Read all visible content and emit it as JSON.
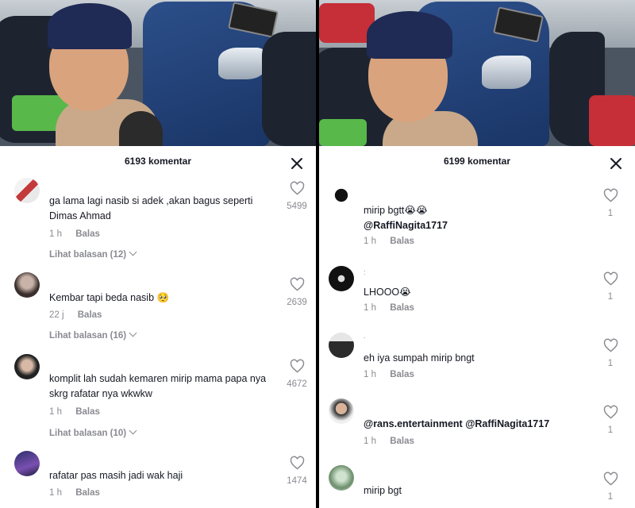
{
  "left": {
    "header_title": "6193 komentar",
    "comments": [
      {
        "text": "ga lama lagi nasib si adek ,akan bagus seperti Dimas Ahmad",
        "time": "1 h",
        "reply_label": "Balas",
        "likes": "5499",
        "view_replies": "Lihat balasan (12)"
      },
      {
        "text": "Kembar tapi beda nasib",
        "emoji": "🥺",
        "time": "22 j",
        "reply_label": "Balas",
        "likes": "2639",
        "view_replies": "Lihat balasan (16)"
      },
      {
        "text": "komplit lah sudah kemaren mirip mama papa nya skrg rafatar nya wkwkw",
        "time": "1 h",
        "reply_label": "Balas",
        "likes": "4672",
        "view_replies": "Lihat balasan (10)"
      },
      {
        "text": "rafatar pas masih jadi wak haji",
        "time": "1 h",
        "reply_label": "Balas",
        "likes": "1474"
      }
    ]
  },
  "right": {
    "header_title": "6199 komentar",
    "comments": [
      {
        "text": "mirip bgtt",
        "emoji": "😭😭",
        "mention": "@RaffiNagita1717",
        "time": "1 h",
        "reply_label": "Balas",
        "likes": "1"
      },
      {
        "username_hint": ":",
        "text": "LHOOO",
        "emoji": "😭",
        "time": "1 h",
        "reply_label": "Balas",
        "likes": "1"
      },
      {
        "username_hint": ".",
        "text": "eh iya sumpah mirip bngt",
        "time": "1 h",
        "reply_label": "Balas",
        "likes": "1"
      },
      {
        "mention": "@rans.entertainment @RaffiNagita1717",
        "time": "1 h",
        "reply_label": "Balas",
        "likes": "1"
      },
      {
        "text": "mirip bgt",
        "likes": "1"
      }
    ]
  },
  "colors": {
    "text": "#161823",
    "muted": "#8a8b91",
    "cap": "#1f2a55",
    "bike_blue": "#2c4f8a"
  },
  "icons": [
    "close-icon",
    "heart-outline-icon",
    "chevron-down-icon"
  ]
}
